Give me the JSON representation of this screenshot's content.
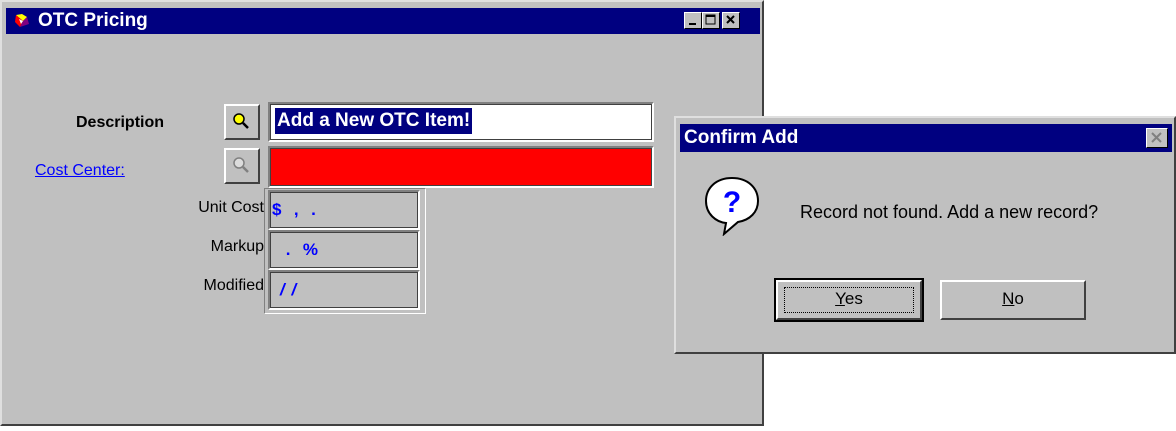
{
  "window": {
    "title": "OTC Pricing"
  },
  "form": {
    "description_label": "Description",
    "description_value": "Add a New OTC Item!",
    "cost_center_label": "Cost Center:",
    "cost_center_color": "#ff0000",
    "unit_cost_label": "Unit Cost",
    "unit_cost_value": "$  ,  .",
    "markup_label": "Markup",
    "markup_value": " .  %",
    "modified_label": "Modified",
    "modified_value": "/ /"
  },
  "dialog": {
    "title": "Confirm Add",
    "icon": "question-icon",
    "message": "Record not found. Add a new record?",
    "yes_mnemonic": "Y",
    "yes_rest": "es",
    "no_mnemonic": "N",
    "no_rest": "o"
  },
  "colors": {
    "titlebar": "#000080",
    "face": "#c0c0c0",
    "field_text": "#0000ff",
    "link": "#0000ff"
  }
}
